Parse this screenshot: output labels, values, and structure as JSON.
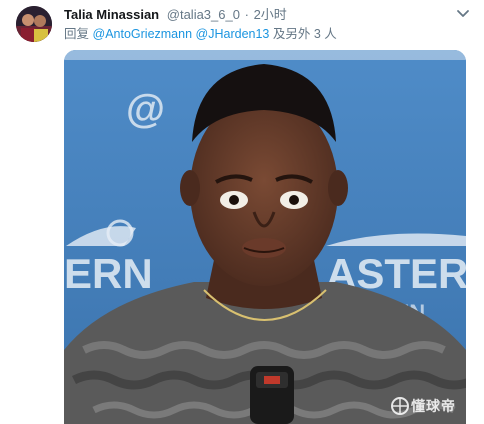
{
  "tweet": {
    "author_name": "Talia Minassian",
    "author_handle": "@talia3_6_0",
    "separator": "·",
    "timestamp": "2小时",
    "reply_prefix": "回复",
    "mentions": [
      "@AntoGriezmann",
      "@JHarden13"
    ],
    "reply_suffix": "及另外 3 人",
    "icons": {
      "avatar": "avatar-photo",
      "menu": "chevron-down-icon",
      "watermark": "ball-logo-icon"
    },
    "media": {
      "type": "photo",
      "watermark_text": "懂球帝",
      "backdrop_text": {
        "top_left": "@",
        "left": "ERN",
        "right": "ASTER",
        "right_sub": "EREN"
      }
    }
  },
  "colors": {
    "name": "#14171a",
    "meta": "#657786",
    "link": "#1b95e0",
    "backdrop_blue": "#4a86c0"
  }
}
